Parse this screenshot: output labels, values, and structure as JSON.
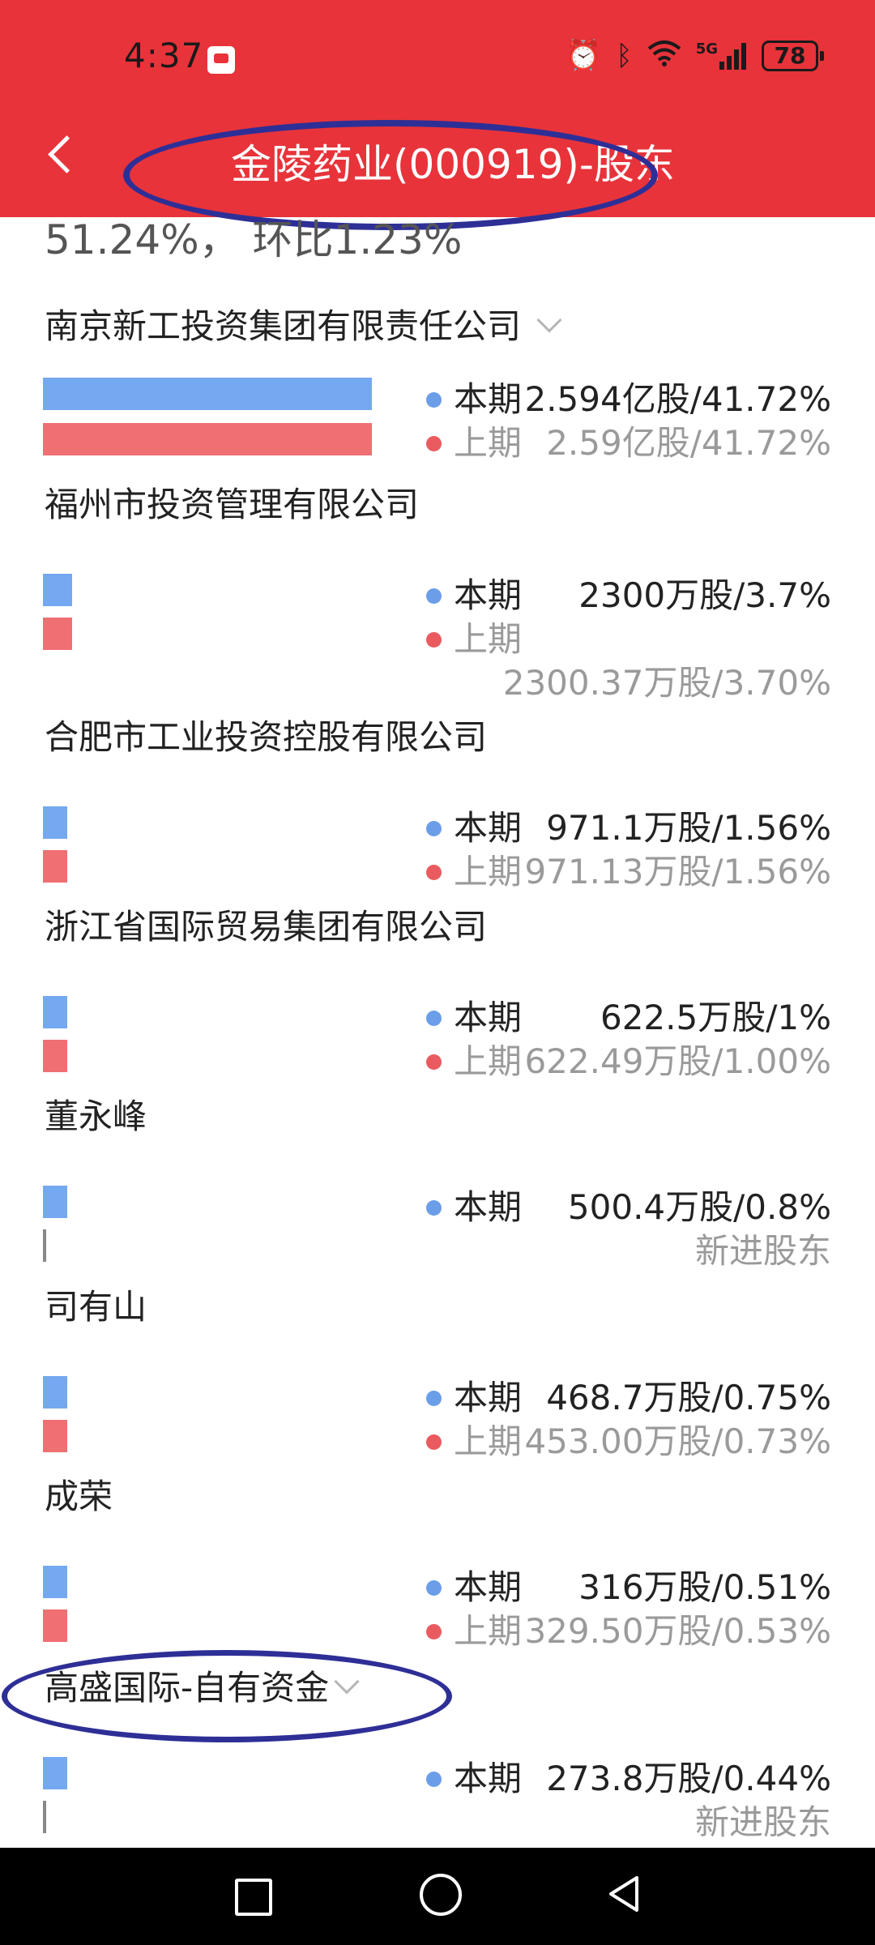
{
  "status_bar": {
    "time": "4:37",
    "network": "5G",
    "battery": "78",
    "icons": [
      "alarm-icon",
      "bluetooth-icon",
      "wifi-icon",
      "signal-icon",
      "battery-icon"
    ]
  },
  "header": {
    "back_icon": "chevron-left-icon",
    "title": "金陵药业(000919)-股东"
  },
  "summary": {
    "text": "51.24%， 环比1.23%"
  },
  "legend": {
    "current_label": "本期",
    "previous_label": "上期",
    "new_holder_label": "新进股东"
  },
  "shareholders": [
    {
      "name": "南京新工投资集团有限责任公司",
      "current": "2.594亿股/41.72%",
      "previous": "2.59亿股/41.72%",
      "is_new": false,
      "has_dropdown": true,
      "current_bar_fraction": 1.0,
      "previous_bar_fraction": 1.0
    },
    {
      "name": "福州市投资管理有限公司",
      "current": "2300万股/3.7%",
      "previous": "2300.37万股/3.70%",
      "is_new": false,
      "has_dropdown": false,
      "current_bar_fraction": 0.089,
      "previous_bar_fraction": 0.089
    },
    {
      "name": "合肥市工业投资控股有限公司",
      "current": "971.1万股/1.56%",
      "previous": "971.13万股/1.56%",
      "is_new": false,
      "has_dropdown": false,
      "current_bar_fraction": 0.037,
      "previous_bar_fraction": 0.037
    },
    {
      "name": "浙江省国际贸易集团有限公司",
      "current": "622.5万股/1%",
      "previous": "622.49万股/1.00%",
      "is_new": false,
      "has_dropdown": false,
      "current_bar_fraction": 0.024,
      "previous_bar_fraction": 0.024
    },
    {
      "name": "董永峰",
      "current": "500.4万股/0.8%",
      "previous": "新进股东",
      "is_new": true,
      "has_dropdown": false,
      "current_bar_fraction": 0.019,
      "previous_bar_fraction": 0
    },
    {
      "name": "司有山",
      "current": "468.7万股/0.75%",
      "previous": "453.00万股/0.73%",
      "is_new": false,
      "has_dropdown": false,
      "current_bar_fraction": 0.018,
      "previous_bar_fraction": 0.017
    },
    {
      "name": "成荣",
      "current": "316万股/0.51%",
      "previous": "329.50万股/0.53%",
      "is_new": false,
      "has_dropdown": false,
      "current_bar_fraction": 0.012,
      "previous_bar_fraction": 0.013
    },
    {
      "name": "高盛国际-自有资金",
      "current": "273.8万股/0.44%",
      "previous": "新进股东",
      "is_new": true,
      "has_dropdown": true,
      "current_bar_fraction": 0.011,
      "previous_bar_fraction": 0
    }
  ],
  "nav_bar": {
    "buttons": [
      "recents-square-icon",
      "home-circle-icon",
      "back-triangle-icon"
    ]
  },
  "colors": {
    "header_red": "#e8333a",
    "current_blue": "#74a8f0",
    "previous_red": "#ef6f73",
    "annotation_blue": "#2e2f96"
  }
}
